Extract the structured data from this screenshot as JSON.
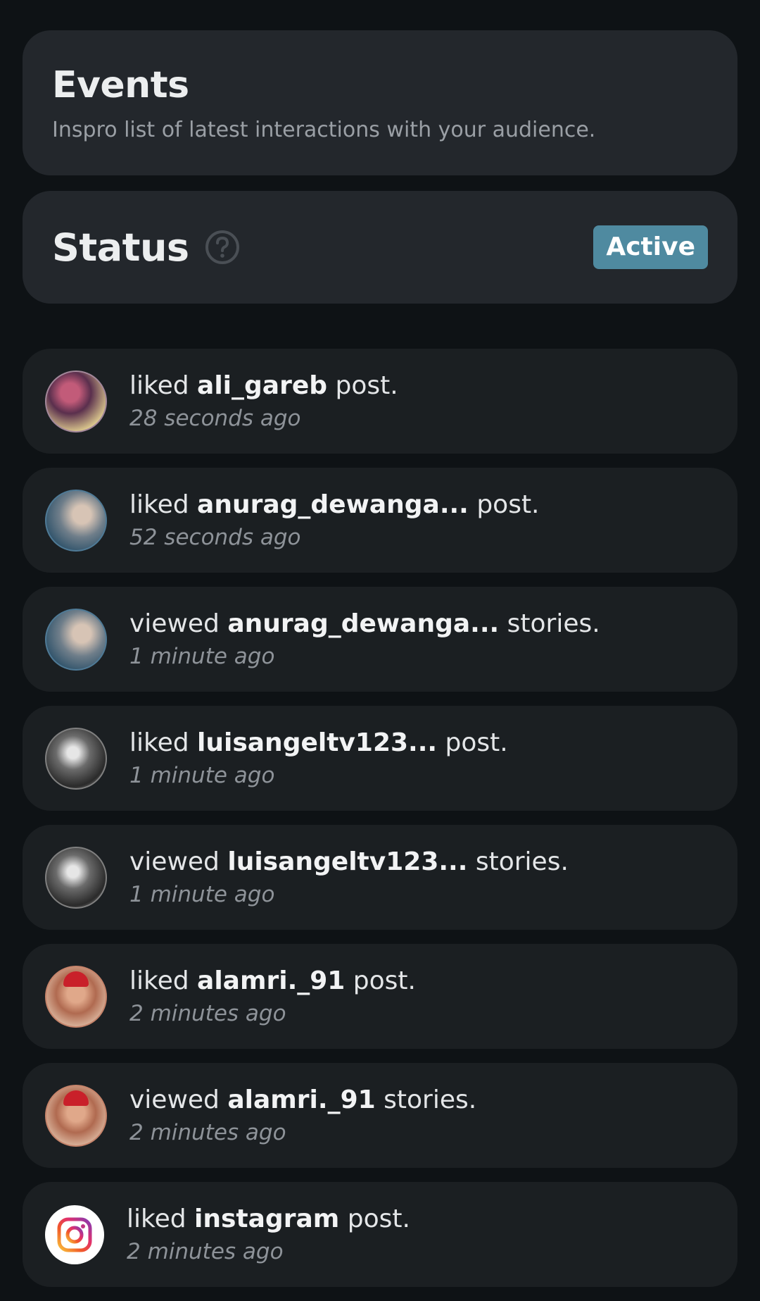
{
  "header": {
    "title": "Events",
    "subtitle": "Inspro list of latest interactions with your audience."
  },
  "status": {
    "title": "Status",
    "badge": "Active",
    "help_icon": "question-circle-icon",
    "badge_color": "#4f8aa0"
  },
  "events": [
    {
      "action": "liked",
      "user": "ali_gareb",
      "object": "post.",
      "time": "28 seconds ago",
      "avatar": "user-avatar"
    },
    {
      "action": "liked",
      "user": "anurag_dewanga...",
      "object": "post.",
      "time": "52 seconds ago",
      "avatar": "user-avatar"
    },
    {
      "action": "viewed",
      "user": "anurag_dewanga...",
      "object": "stories.",
      "time": "1 minute ago",
      "avatar": "user-avatar"
    },
    {
      "action": "liked",
      "user": "luisangeltv123...",
      "object": "post.",
      "time": "1 minute ago",
      "avatar": "user-avatar"
    },
    {
      "action": "viewed",
      "user": "luisangeltv123...",
      "object": "stories.",
      "time": "1 minute ago",
      "avatar": "user-avatar"
    },
    {
      "action": "liked",
      "user": "alamri._91",
      "object": "post.",
      "time": "2 minutes ago",
      "avatar": "user-avatar"
    },
    {
      "action": "viewed",
      "user": "alamri._91",
      "object": "stories.",
      "time": "2 minutes ago",
      "avatar": "user-avatar"
    },
    {
      "action": "liked",
      "user": "instagram",
      "object": "post.",
      "time": "2 minutes ago",
      "avatar": "instagram-logo-icon"
    }
  ]
}
